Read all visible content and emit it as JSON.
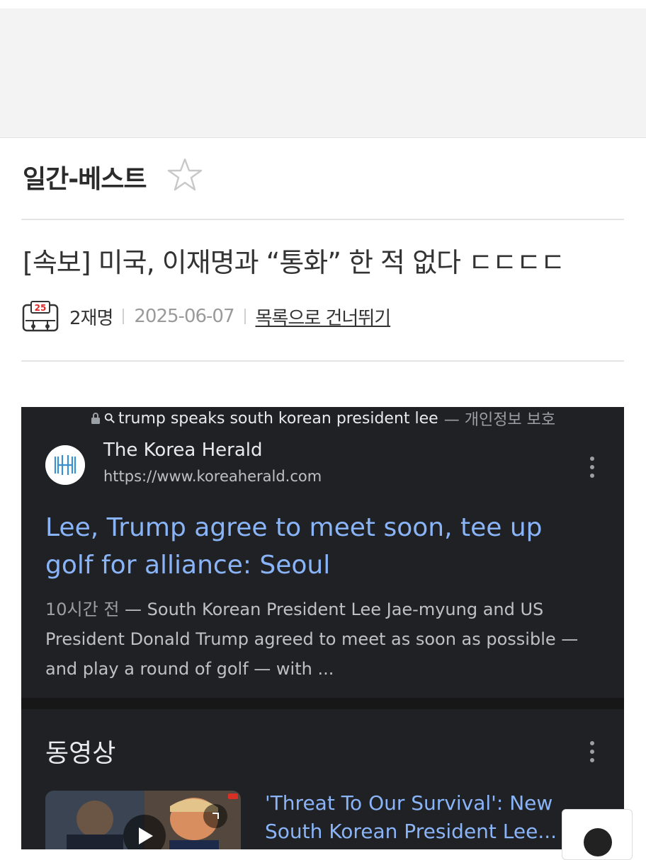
{
  "board": {
    "title": "일간-베스트"
  },
  "post": {
    "title": "[속보] 미국, 이재명과 “통화” 한 적 없다 ㄷㄷㄷㄷ",
    "author": "2재명",
    "date": "2025-06-07",
    "skip_link": "목록으로 건너뛰기",
    "avatar_badge": "25"
  },
  "embedded": {
    "query": "trump speaks south korean president lee",
    "privacy_label": "— 개인정보 보호",
    "result": {
      "site_name": "The Korea Herald",
      "site_url": "https://www.koreaherald.com",
      "title": "Lee, Trump agree to meet soon, tee up golf for alliance: Seoul",
      "time": "10시간 전",
      "snippet": " — South Korean President Lee Jae-myung and US President Donald Trump agreed to meet as soon as possible — and play a round of golf — with ..."
    },
    "videos": {
      "heading": "동영상",
      "first_title_line1": "'Threat To Our Survival': New",
      "first_title_line2": "South Korean President Lee..."
    }
  },
  "colors": {
    "link_blue": "#8ab4f8",
    "dark_bg": "#202124",
    "star_outline": "#c8c8c8"
  }
}
